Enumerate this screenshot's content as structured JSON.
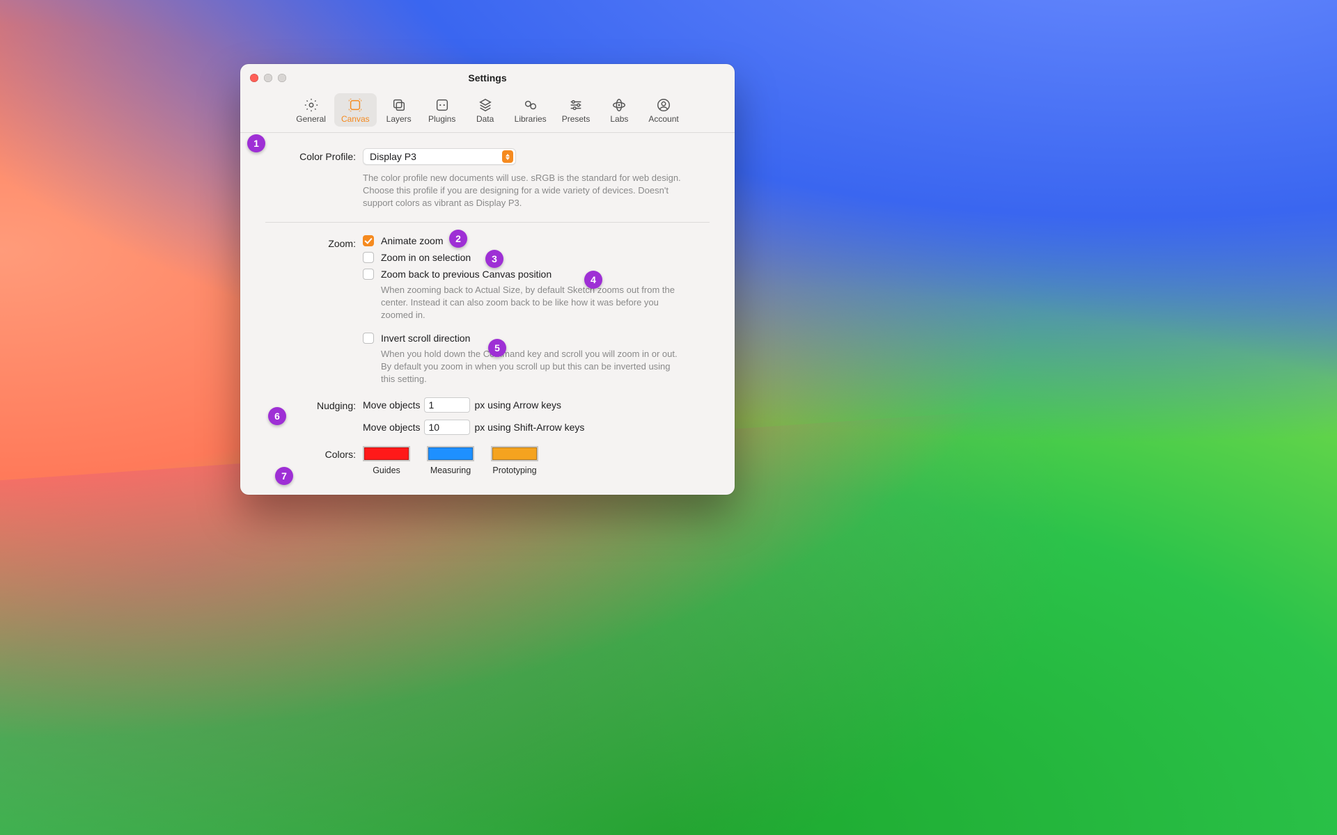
{
  "window": {
    "title": "Settings"
  },
  "tabs": {
    "general": {
      "label": "General"
    },
    "canvas": {
      "label": "Canvas"
    },
    "layers": {
      "label": "Layers"
    },
    "plugins": {
      "label": "Plugins"
    },
    "data": {
      "label": "Data"
    },
    "libraries": {
      "label": "Libraries"
    },
    "presets": {
      "label": "Presets"
    },
    "labs": {
      "label": "Labs"
    },
    "account": {
      "label": "Account"
    }
  },
  "color_profile": {
    "label": "Color Profile:",
    "value": "Display P3",
    "help": "The color profile new documents will use. sRGB is the standard for web design. Choose this profile if you are designing for a wide variety of devices. Doesn't support colors as vibrant as Display P3."
  },
  "zoom": {
    "label": "Zoom:",
    "animate": "Animate zoom",
    "on_selection": "Zoom in on selection",
    "back_to_prev": "Zoom back to previous Canvas position",
    "back_help": "When zooming back to Actual Size, by default Sketch zooms out from the center. Instead it can also zoom back to be like how it was before you zoomed in.",
    "invert": "Invert scroll direction",
    "invert_help": "When you hold down the Command key and scroll you will zoom in or out. By default you zoom in when you scroll up but this can be inverted using this setting."
  },
  "nudging": {
    "label": "Nudging:",
    "move_prefix": "Move objects",
    "arrow_value": "1",
    "arrow_suffix": "px using Arrow keys",
    "shift_value": "10",
    "shift_suffix": "px using Shift-Arrow keys"
  },
  "colors": {
    "label": "Colors:",
    "guides": "Guides",
    "measuring": "Measuring",
    "prototyping": "Prototyping"
  },
  "annotations": {
    "1": "1",
    "2": "2",
    "3": "3",
    "4": "4",
    "5": "5",
    "6": "6",
    "7": "7"
  }
}
